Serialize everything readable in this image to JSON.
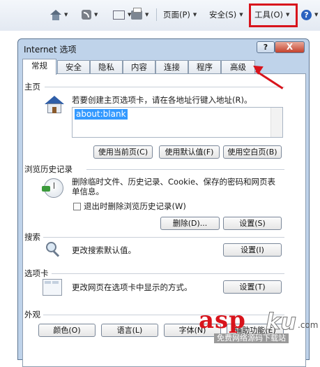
{
  "cmdbar": {
    "icons": [
      "home-icon",
      "rss-icon",
      "mail-icon",
      "print-icon",
      "help-icon"
    ],
    "page_menu": "页面(P)",
    "safety_menu": "安全(S)",
    "tools_menu": "工具(O)",
    "highlight_color": "#d8141c"
  },
  "dialog": {
    "title": "Internet 选项",
    "help_button": "?",
    "close_button": "X",
    "tabs": [
      {
        "label": "常规",
        "active": true
      },
      {
        "label": "安全"
      },
      {
        "label": "隐私"
      },
      {
        "label": "内容"
      },
      {
        "label": "连接"
      },
      {
        "label": "程序"
      },
      {
        "label": "高级"
      }
    ],
    "home": {
      "title": "主页",
      "desc": "若要创建主页选项卡，请在各地址行键入地址(R)。",
      "value": "about:blank",
      "btn_current": "使用当前页(C)",
      "btn_default": "使用默认值(F)",
      "btn_blank": "使用空白页(B)"
    },
    "history": {
      "title": "浏览历史记录",
      "desc": "删除临时文件、历史记录、Cookie、保存的密码和网页表单信息。",
      "checkbox": "退出时删除浏览历史记录(W)",
      "btn_delete": "删除(D)...",
      "btn_settings": "设置(S)"
    },
    "search": {
      "title": "搜索",
      "desc": "更改搜索默认值。",
      "btn_settings": "设置(I)"
    },
    "tabs_group": {
      "title": "选项卡",
      "desc": "更改网页在选项卡中显示的方式。",
      "btn_settings": "设置(T)"
    },
    "appearance": {
      "title": "外观",
      "btn_colors": "颜色(O)",
      "btn_languages": "语言(L)",
      "btn_fonts": "字体(N)",
      "btn_accessibility": "辅助功能(E)"
    }
  },
  "watermark": {
    "asp": "asp",
    "ku": "ku",
    "com": ".com",
    "sub": "免费网络源码下载站"
  }
}
